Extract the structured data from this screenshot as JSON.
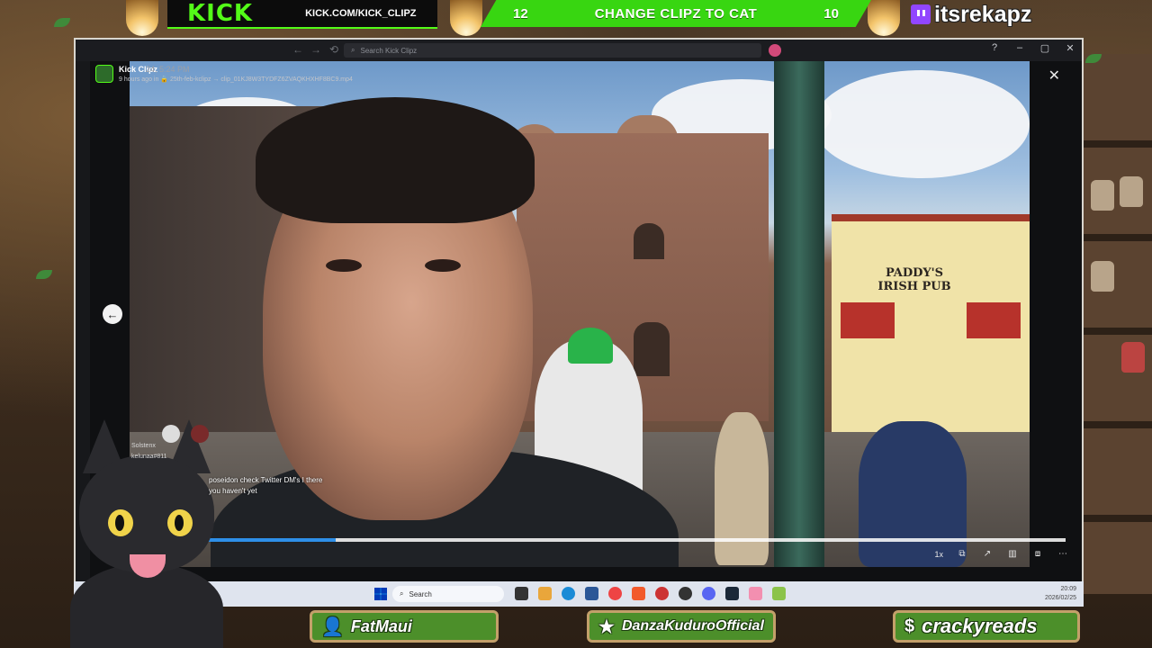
{
  "overlay": {
    "kick_logo": "KICK",
    "kick_url": "KICK.COM/KICK_CLIPZ",
    "vote": {
      "left_count": "12",
      "title": "CHANGE CLIPZ TO CAT",
      "right_count": "10"
    },
    "twitch_name": "itsrekapz",
    "nameplates": [
      {
        "icon": "person-icon",
        "name": "FatMaui"
      },
      {
        "icon": "star-icon",
        "name": "DanzaKuduroOfficial"
      },
      {
        "icon": "dollar-icon",
        "name": "crackyreads"
      }
    ]
  },
  "browser": {
    "search_placeholder": "Search Kick Clipz"
  },
  "viewer": {
    "channel_name": "Kick Clipz",
    "ghost_timestamp": "24, 5:24 PM",
    "clip_meta": "9 hours ago in 🔒 25th-feb-kclipz → clip_01KJ8W3TYDFZ6ZVAQKHXHF8BC9.mp4",
    "progress": 0.22,
    "speed": "1x",
    "video_sign": "PADDY'S IRISH PUB"
  },
  "chat": {
    "usernames": [
      "Solstenx",
      "kelunaa#811"
    ],
    "message": "poseidon check Twitter DM's I there you haven't yet"
  },
  "taskbar": {
    "search_label": "Search",
    "time": "20:09",
    "date": "2026/02/25"
  },
  "colors": {
    "kick_green": "#53fc18",
    "vote_green": "#38d611",
    "twitch_purple": "#9146ff",
    "progress_blue": "#2e8fe8",
    "plate_green": "#4c8f2a"
  }
}
